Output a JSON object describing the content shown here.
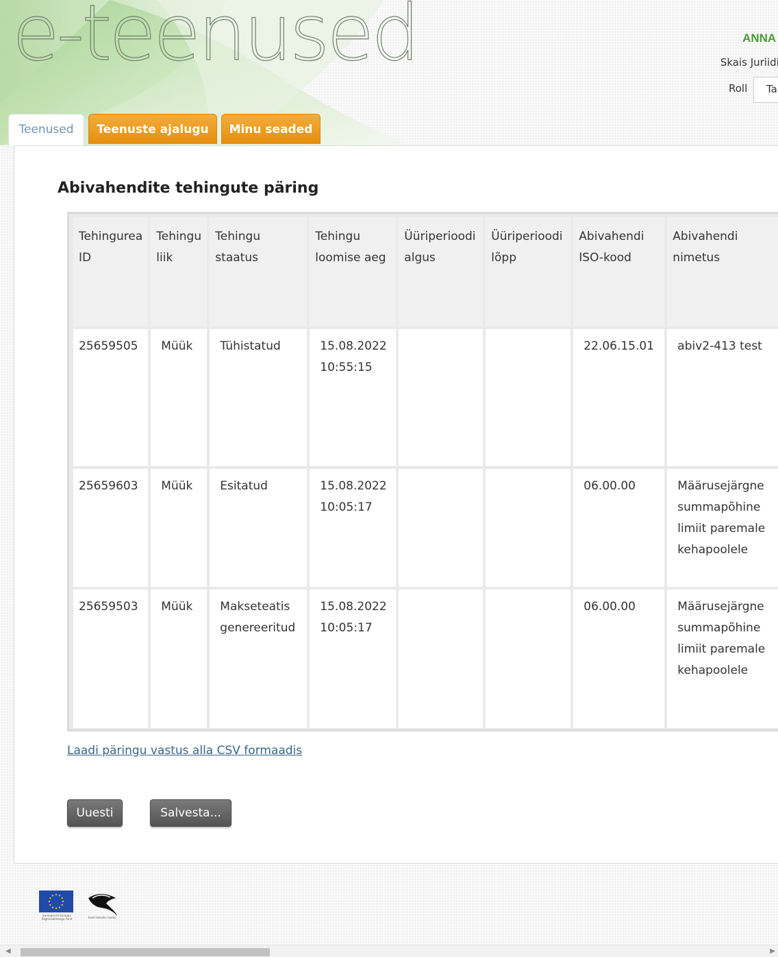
{
  "header": {
    "logo_text": "e-teenused",
    "user_name": "ANNA I",
    "user_org": "Skais Juriidil",
    "role_label": "Roll",
    "role_value": "Ta"
  },
  "tabs": [
    {
      "label": "Teenused",
      "active": true
    },
    {
      "label": "Teenuste ajalugu",
      "active": false
    },
    {
      "label": "Minu seaded",
      "active": false
    }
  ],
  "page_title": "Abivahendite tehingute päring",
  "table": {
    "columns": [
      "Tehingurea ID",
      "Tehingu liik",
      "Tehingu staatus",
      "Tehingu loomise aeg",
      "Üüriperioodi algus",
      "Üüriperioodi lõpp",
      "Abivahendi ISO-kood",
      "Abivahendi nimetus"
    ],
    "rows": [
      [
        "25659505",
        "Müük",
        "Tühistatud",
        "15.08.2022 10:55:15",
        "",
        "",
        "22.06.15.01",
        "abiv2-413 test"
      ],
      [
        "25659603",
        "Müük",
        "Esitatud",
        "15.08.2022 10:05:17",
        "",
        "",
        "06.00.00",
        "Määrusejärgne summapõhine limiit paremale kehapoolele"
      ],
      [
        "25659503",
        "Müük",
        "Makseteatis genereeritud",
        "15.08.2022 10:05:17",
        "",
        "",
        "06.00.00",
        "Määrusejärgne summapõhine limiit paremale kehapoolele"
      ]
    ]
  },
  "csv_link": "Laadi päringu vastus alla CSV formaadis",
  "buttons": {
    "new": "Uuesti",
    "save": "Salvesta..."
  },
  "footer": {
    "eu_caption": "Euroopa Liit Euroopa Regionaalarengu Fond",
    "est_caption": "Eesti tuleviku heaks"
  },
  "colors": {
    "tab_orange": "#e9981f",
    "user_name_green": "#4c9a36",
    "link_blue": "#356688",
    "button_gray": "#666666"
  }
}
